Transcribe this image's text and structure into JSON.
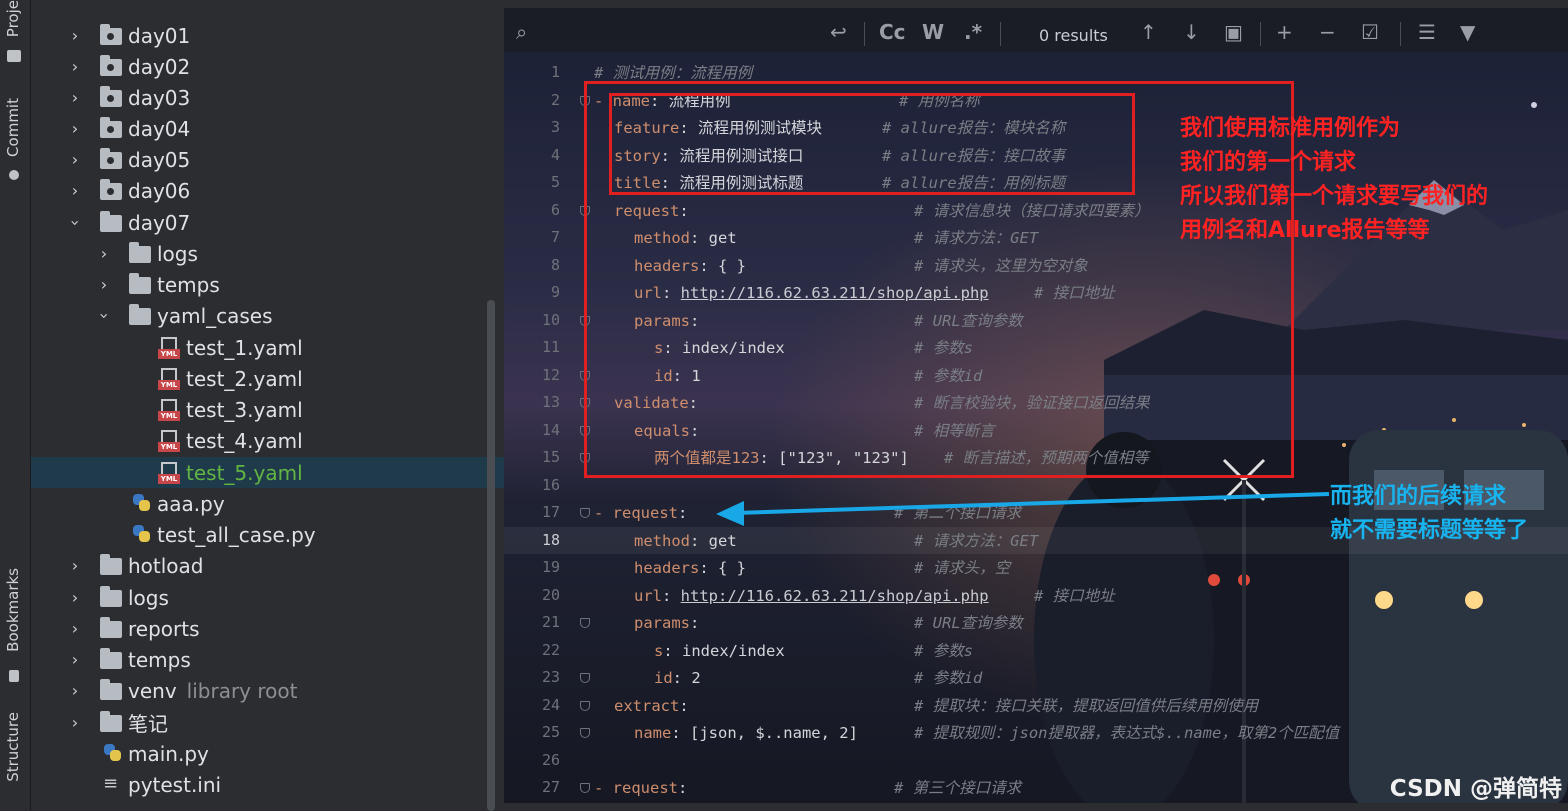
{
  "sidebar": {
    "project_label": "Proje",
    "commit_label": "Commit",
    "bookmarks_label": "Bookmarks",
    "structure_label": "Structure"
  },
  "tree": {
    "items": [
      {
        "label": "day01"
      },
      {
        "label": "day02"
      },
      {
        "label": "day03"
      },
      {
        "label": "day04"
      },
      {
        "label": "day05"
      },
      {
        "label": "day06"
      },
      {
        "label": "day07"
      },
      {
        "label": "logs"
      },
      {
        "label": "temps"
      },
      {
        "label": "yaml_cases"
      },
      {
        "label": "test_1.yaml"
      },
      {
        "label": "test_2.yaml"
      },
      {
        "label": "test_3.yaml"
      },
      {
        "label": "test_4.yaml"
      },
      {
        "label": "test_5.yaml"
      },
      {
        "label": "aaa.py"
      },
      {
        "label": "test_all_case.py"
      },
      {
        "label": "hotload"
      },
      {
        "label": "logs"
      },
      {
        "label": "reports"
      },
      {
        "label": "temps"
      },
      {
        "label": "venv",
        "sub": "library root"
      },
      {
        "label": "笔记"
      },
      {
        "label": "main.py"
      },
      {
        "label": "pytest.ini"
      }
    ],
    "yml_tag": "YML"
  },
  "toolbar": {
    "match_case": "Cc",
    "words": "W",
    "regex": ".*",
    "results": "0 results"
  },
  "editor": {
    "line_numbers": [
      "1",
      "2",
      "3",
      "4",
      "5",
      "6",
      "7",
      "8",
      "9",
      "10",
      "11",
      "12",
      "13",
      "14",
      "15",
      "16",
      "17",
      "18",
      "19",
      "20",
      "21",
      "22",
      "23",
      "24",
      "25",
      "26",
      "27"
    ],
    "lines": {
      "l1_c": "# 测试用例：流程用例",
      "l2_dash": "- ",
      "l2_k": "name",
      "l2_v": ": 流程用例",
      "l2_c": "# 用例名称",
      "l3_k": "feature",
      "l3_v": ": 流程用例测试模块",
      "l3_c": "# allure报告：模块名称",
      "l4_k": "story",
      "l4_v": ": 流程用例测试接口",
      "l4_c": "# allure报告：接口故事",
      "l5_k": "title",
      "l5_v": ": 流程用例测试标题",
      "l5_c": "# allure报告：用例标题",
      "l6_k": "request",
      "l6_v": ":",
      "l6_c": "# 请求信息块（接口请求四要素）",
      "l7_k": "method",
      "l7_v": ": get",
      "l7_c": "# 请求方法：GET",
      "l8_k": "headers",
      "l8_v": ": { }",
      "l8_c": "# 请求头，这里为空对象",
      "l9_k": "url",
      "l9_s": ": ",
      "l9_u": "http://116.62.63.211/shop/api.php",
      "l9_c": "# 接口地址",
      "l10_k": "params",
      "l10_v": ":",
      "l10_c": "# URL查询参数",
      "l11_k": "s",
      "l11_v": ": index/index",
      "l11_c": "# 参数s",
      "l12_k": "id",
      "l12_v": ": 1",
      "l12_c": "# 参数id",
      "l13_k": "validate",
      "l13_v": ":",
      "l13_c": "# 断言校验块，验证接口返回结果",
      "l14_k": "equals",
      "l14_v": ":",
      "l14_c": "# 相等断言",
      "l15_k": "两个值都是123",
      "l15_v": ": [\"123\", \"123\"]",
      "l15_c": "# 断言描述，预期两个值相等",
      "l17_dash": "- ",
      "l17_k": "request",
      "l17_v": ":",
      "l17_c": "# 第二个接口请求",
      "l18_k": "method",
      "l18_v": ": get",
      "l18_c": "# 请求方法：GET",
      "l19_k": "headers",
      "l19_v": ": { }",
      "l19_c": "# 请求头，空",
      "l20_k": "url",
      "l20_s": ": ",
      "l20_u": "http://116.62.63.211/shop/api.php",
      "l20_c": "# 接口地址",
      "l21_k": "params",
      "l21_v": ":",
      "l21_c": "# URL查询参数",
      "l22_k": "s",
      "l22_v": ": index/index",
      "l22_c": "# 参数s",
      "l23_k": "id",
      "l23_v": ": 2",
      "l23_c": "# 参数id",
      "l24_k": "extract",
      "l24_v": ":",
      "l24_c": "# 提取块：接口关联，提取返回值供后续用例使用",
      "l25_k": "name",
      "l25_v": ": [json, $..name, 2]",
      "l25_c": "# 提取规则：json提取器，表达式$..name，取第2个匹配值",
      "l27_dash": "- ",
      "l27_k": "request",
      "l27_v": ":",
      "l27_c": "# 第三个接口请求"
    }
  },
  "annotations": {
    "red_note": [
      "我们使用标准用例作为",
      "我们的第一个请求",
      "所以我们第一个请求要写我们的",
      "用例名和Allure报告等等"
    ],
    "blue_note": [
      "而我们的后续请求",
      "就不需要标题等等了"
    ],
    "red_color": "#ff2222",
    "blue_color": "#18b4f0"
  },
  "watermark": "CSDN @弹简特"
}
